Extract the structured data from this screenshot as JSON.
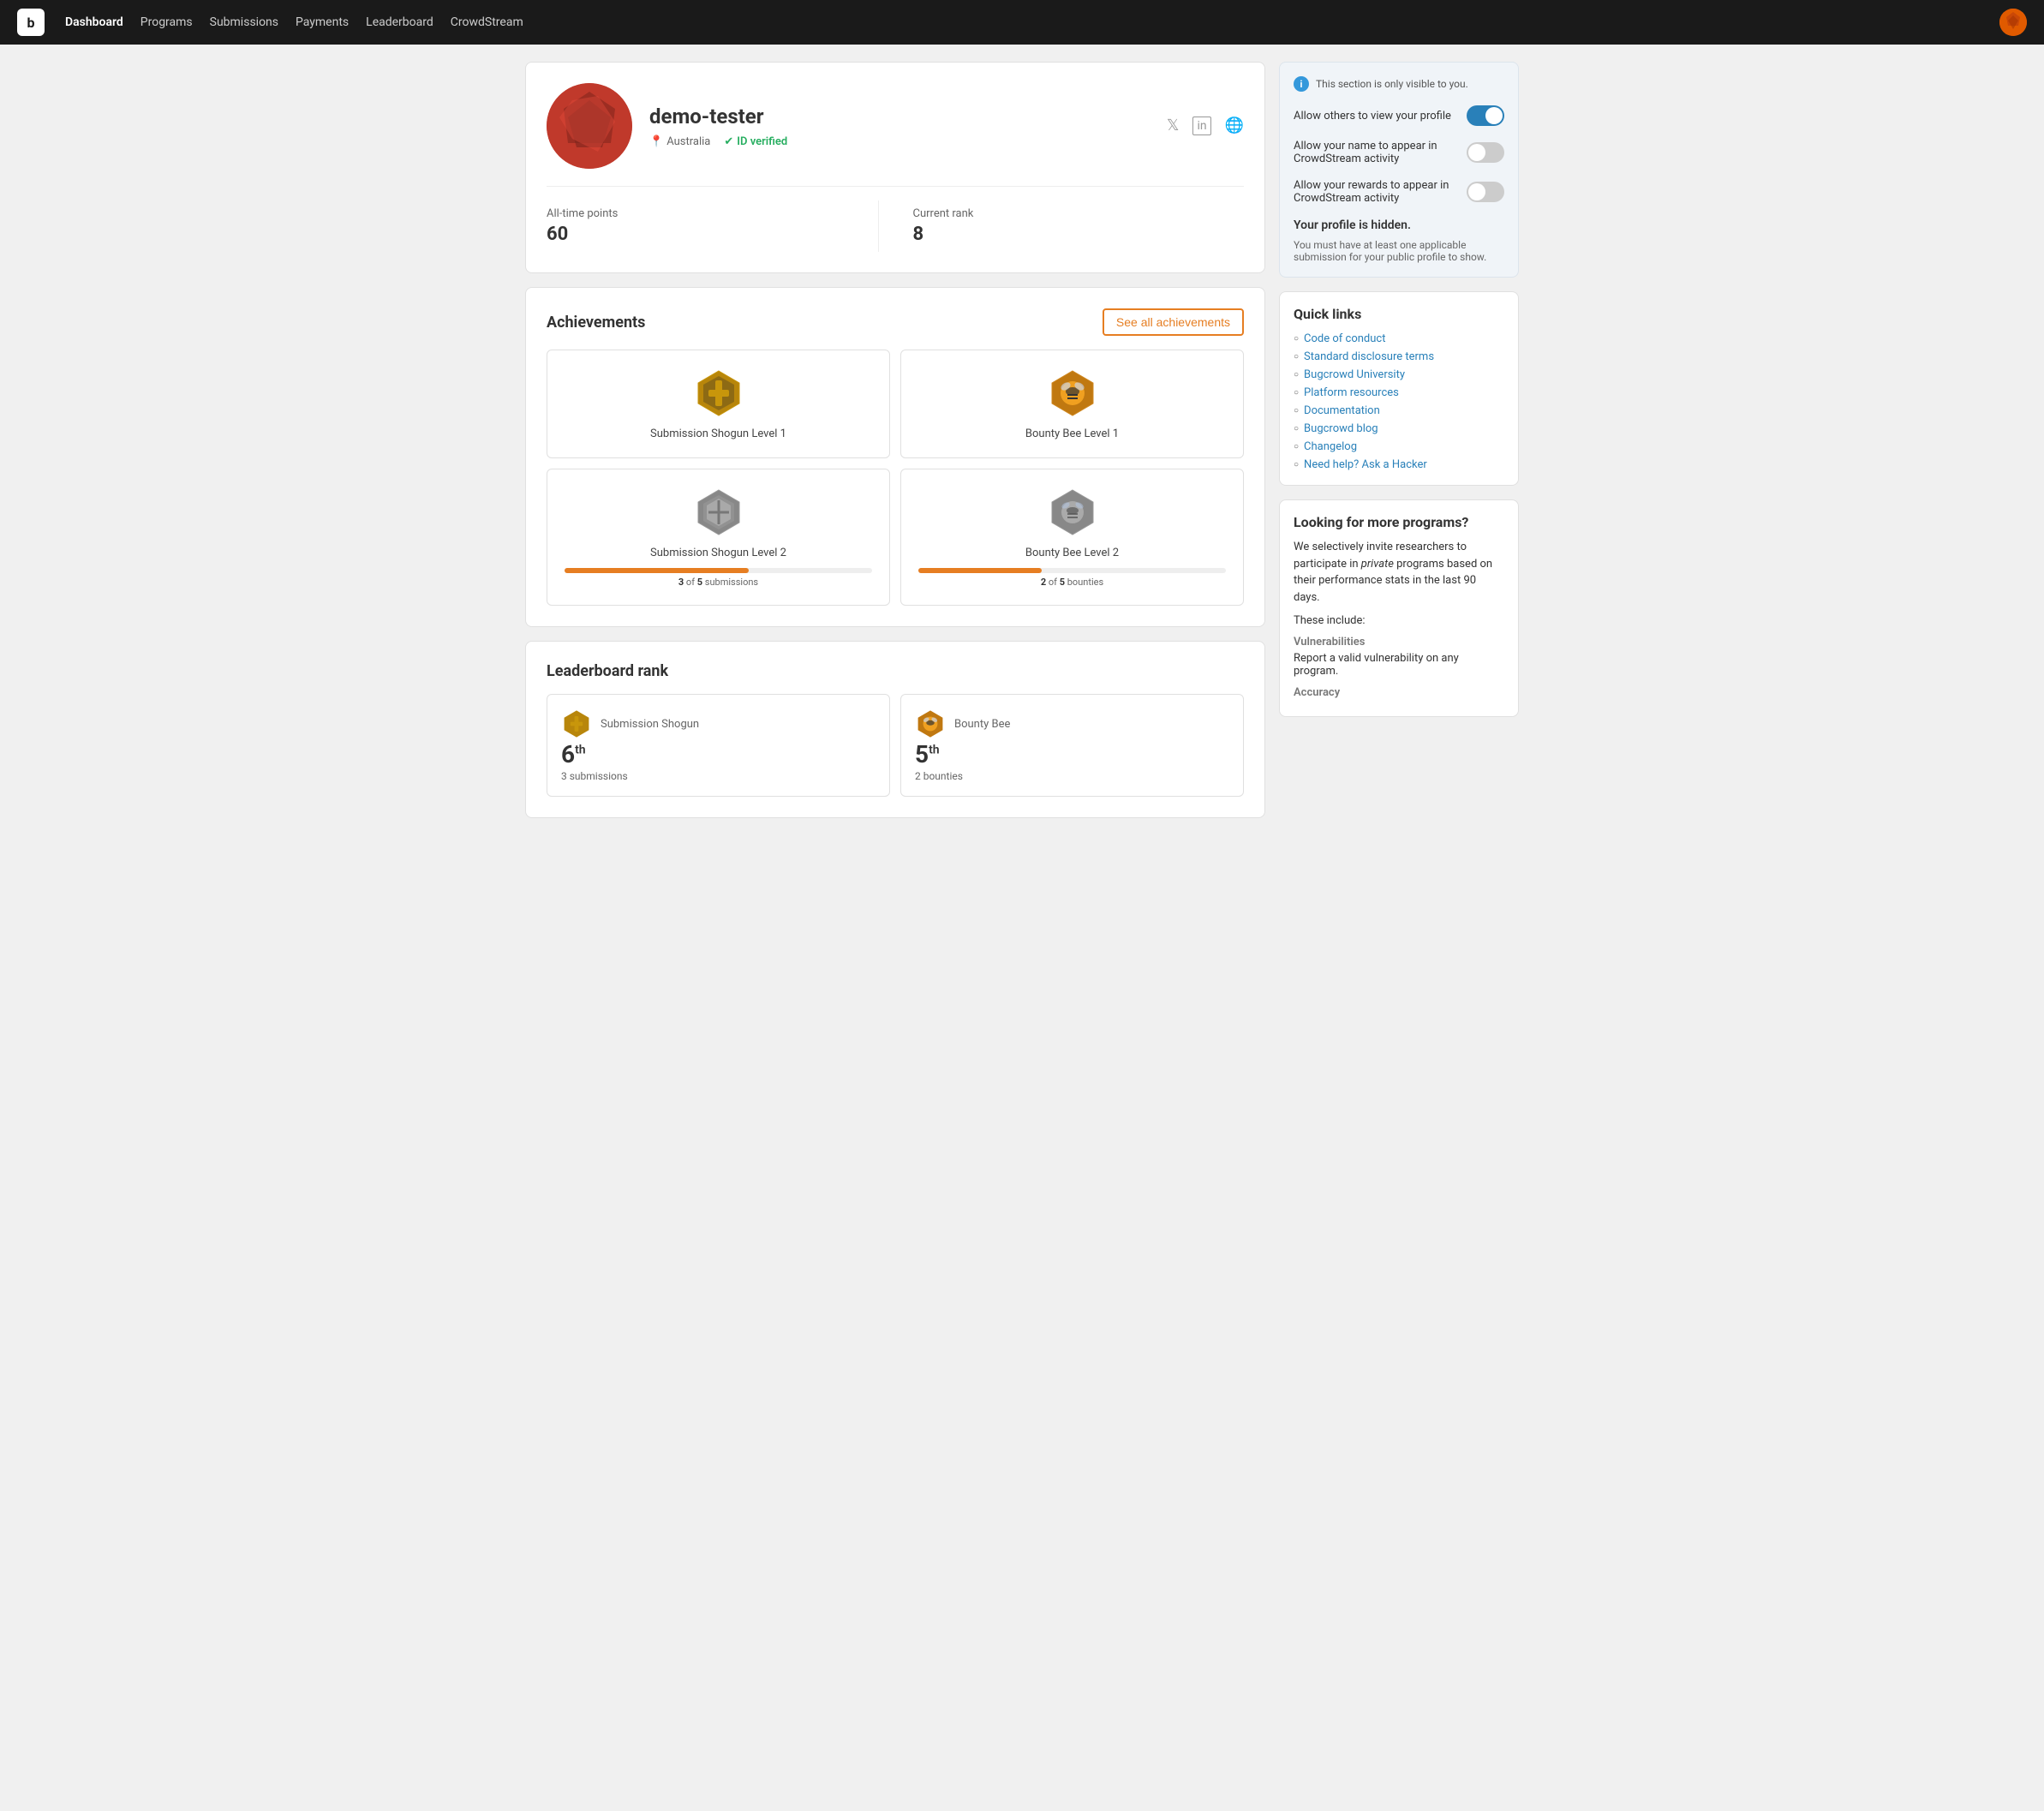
{
  "navbar": {
    "logo": "b",
    "links": [
      {
        "label": "Dashboard",
        "active": true
      },
      {
        "label": "Programs",
        "active": false
      },
      {
        "label": "Submissions",
        "active": false
      },
      {
        "label": "Payments",
        "active": false
      },
      {
        "label": "Leaderboard",
        "active": false
      },
      {
        "label": "CrowdStream",
        "active": false
      }
    ]
  },
  "profile": {
    "username": "demo-tester",
    "location": "Australia",
    "id_verified": "ID verified",
    "all_time_points_label": "All-time points",
    "all_time_points_value": "60",
    "current_rank_label": "Current rank",
    "current_rank_value": "8"
  },
  "achievements": {
    "title": "Achievements",
    "see_all_label": "See all achievements",
    "items": [
      {
        "id": "submission-shogun-1",
        "label": "Submission Shogun Level 1",
        "type": "shogun",
        "level": 1,
        "has_progress": false
      },
      {
        "id": "bounty-bee-1",
        "label": "Bounty Bee Level 1",
        "type": "bee",
        "level": 1,
        "has_progress": false
      },
      {
        "id": "submission-shogun-2",
        "label": "Submission Shogun Level 2",
        "type": "shogun",
        "level": 2,
        "has_progress": true,
        "progress_current": 3,
        "progress_total": 5,
        "progress_unit": "submissions",
        "progress_pct": 60
      },
      {
        "id": "bounty-bee-2",
        "label": "Bounty Bee Level 2",
        "type": "bee",
        "level": 2,
        "has_progress": true,
        "progress_current": 2,
        "progress_total": 5,
        "progress_unit": "bounties",
        "progress_pct": 40
      }
    ]
  },
  "leaderboard": {
    "title": "Leaderboard rank",
    "items": [
      {
        "name": "Submission Shogun",
        "rank": "6",
        "rank_suffix": "th",
        "sub_label": "3 submissions",
        "type": "shogun"
      },
      {
        "name": "Bounty Bee",
        "rank": "5",
        "rank_suffix": "th",
        "sub_label": "2 bounties",
        "type": "bee"
      }
    ]
  },
  "side_panel": {
    "visibility_note": "This section is only visible to you.",
    "toggles": [
      {
        "label": "Allow others to view your profile",
        "on": true
      },
      {
        "label": "Allow your name to appear in CrowdStream activity",
        "on": false
      },
      {
        "label": "Allow your rewards to appear in CrowdStream activity",
        "on": false
      }
    ],
    "profile_hidden_label": "Your profile is hidden.",
    "profile_hidden_desc": "You must have at least one applicable submission for your public profile to show."
  },
  "quick_links": {
    "title": "Quick links",
    "links": [
      {
        "label": "Code of conduct",
        "url": "#"
      },
      {
        "label": "Standard disclosure terms",
        "url": "#"
      },
      {
        "label": "Bugcrowd University",
        "url": "#"
      },
      {
        "label": "Platform resources",
        "url": "#"
      },
      {
        "label": "Documentation",
        "url": "#"
      },
      {
        "label": "Bugcrowd blog",
        "url": "#"
      },
      {
        "label": "Changelog",
        "url": "#"
      },
      {
        "label": "Need help? Ask a Hacker",
        "url": "#"
      }
    ]
  },
  "more_programs": {
    "title": "Looking for more programs?",
    "desc": "We selectively invite researchers to participate in private programs based on their performance stats in the last 90 days.",
    "these_include": "These include:",
    "categories": [
      {
        "name": "Vulnerabilities",
        "desc": "Report a valid vulnerability on any program."
      },
      {
        "name": "Accuracy",
        "desc": ""
      }
    ]
  }
}
